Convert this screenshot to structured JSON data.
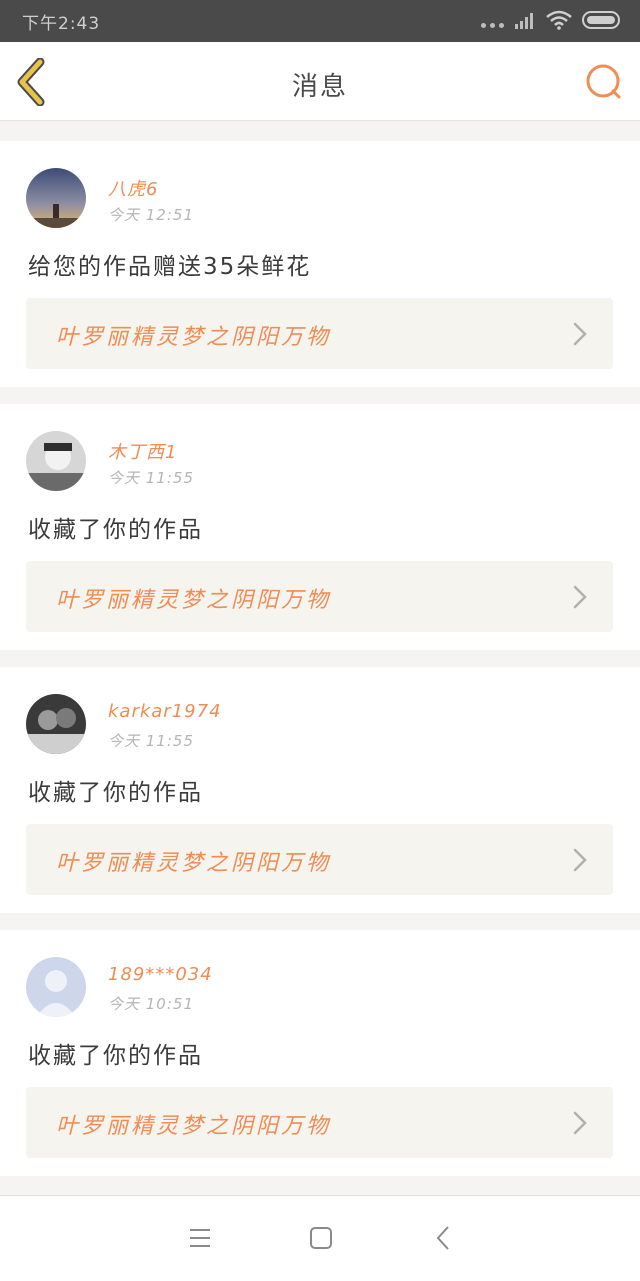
{
  "status_bar": {
    "time": "下午2:43",
    "icons": [
      "more-dots-icon",
      "signal-icon",
      "wifi-icon",
      "battery-icon"
    ]
  },
  "header": {
    "title": "消息",
    "back_icon": "chevron-left-icon",
    "search_icon": "search-icon",
    "accent_color": "#f08c54",
    "back_color": "#e8c34a"
  },
  "messages": [
    {
      "username": "八虎6",
      "time": "今天 12:51",
      "text": "给您的作品赠送35朵鲜花",
      "work_title": "叶罗丽精灵梦之阴阳万物"
    },
    {
      "username": "木丁西1",
      "time": "今天 11:55",
      "text": "收藏了你的作品",
      "work_title": "叶罗丽精灵梦之阴阳万物"
    },
    {
      "username": "karkar1974",
      "time": "今天 11:55",
      "text": "收藏了你的作品",
      "work_title": "叶罗丽精灵梦之阴阳万物"
    },
    {
      "username": "189***034",
      "time": "今天 10:51",
      "text": "收藏了你的作品",
      "work_title": "叶罗丽精灵梦之阴阳万物"
    }
  ],
  "nav_bar": {
    "icons": [
      "menu-icon",
      "home-square-icon",
      "back-triangle-icon"
    ]
  }
}
